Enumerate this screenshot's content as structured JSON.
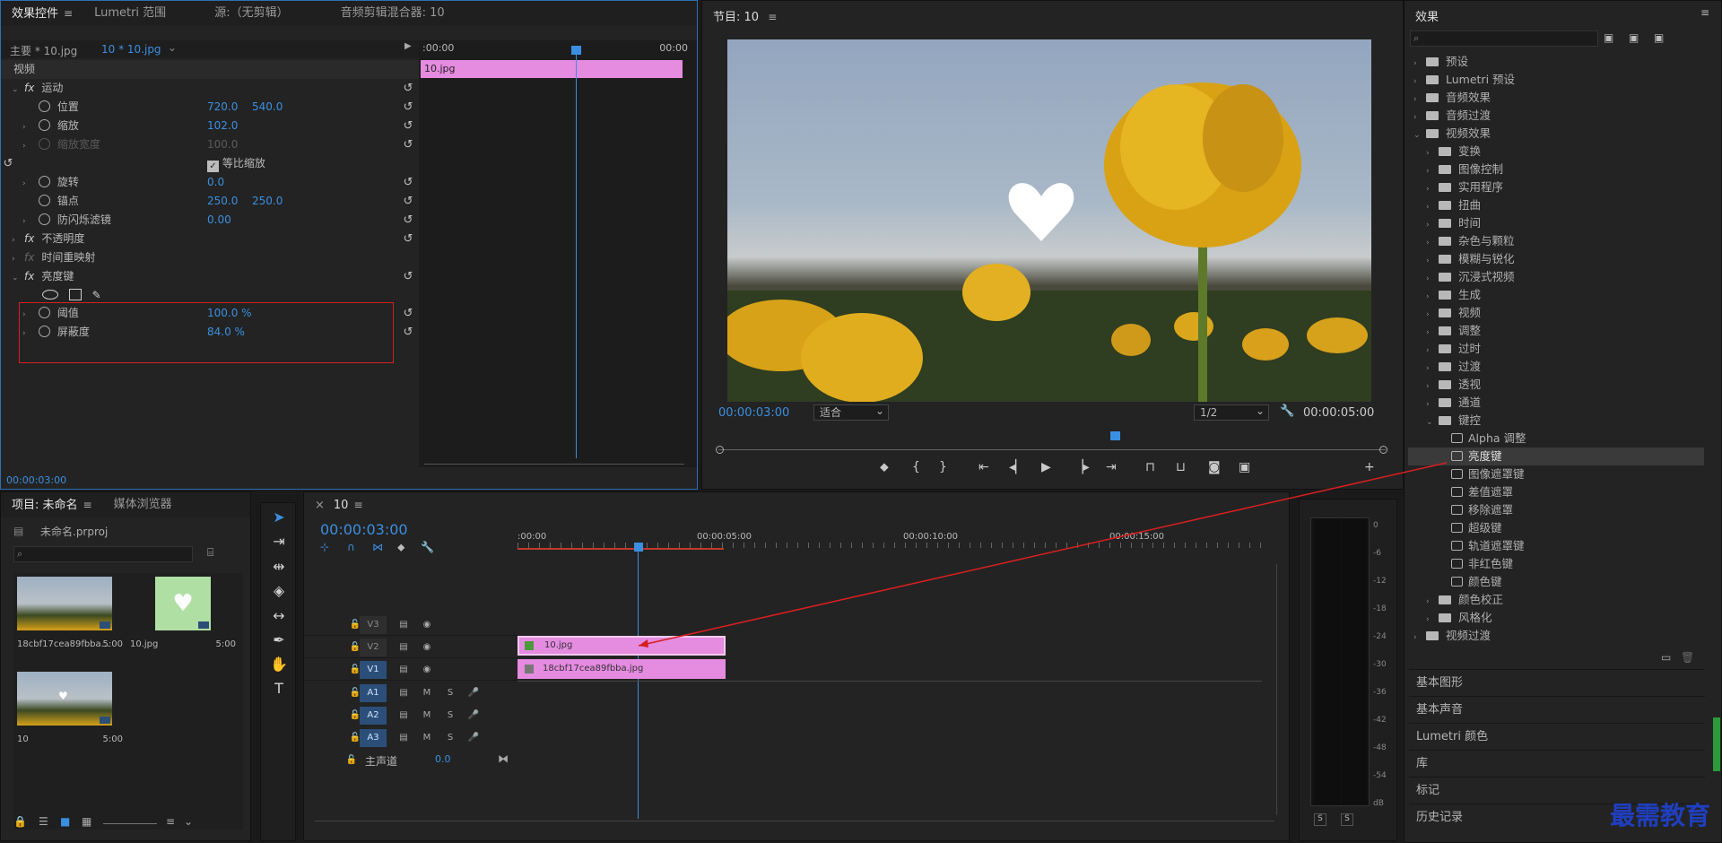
{
  "effect_controls": {
    "tabs": [
      "效果控件",
      "Lumetri 范围",
      "源:（无剪辑）",
      "音频剪辑混合器: 10"
    ],
    "master_clip": "主要 * 10.jpg",
    "seq_clip": "10 * 10.jpg",
    "ruler_start": ":00:00",
    "ruler_end": "00:00",
    "clip_bar": "10.jpg",
    "section_video": "视频",
    "motion": "运动",
    "props": [
      {
        "name": "位置",
        "v1": "720.0",
        "v2": "540.0"
      },
      {
        "name": "缩放",
        "v1": "102.0"
      },
      {
        "name": "缩放宽度",
        "v1": "100.0"
      },
      {
        "name": "等比缩放"
      },
      {
        "name": "旋转",
        "v1": "0.0"
      },
      {
        "name": "锚点",
        "v1": "250.0",
        "v2": "250.0"
      },
      {
        "name": "防闪烁滤镜",
        "v1": "0.00"
      }
    ],
    "opacity": "不透明度",
    "timeremap": "时间重映射",
    "lumakey": "亮度键",
    "threshold": {
      "name": "阈值",
      "value": "100.0 %"
    },
    "cutoff": {
      "name": "屏蔽度",
      "value": "84.0 %"
    },
    "timecode": "00:00:03:00"
  },
  "program": {
    "title": "节目: 10",
    "timecode": "00:00:03:00",
    "fit": "适合",
    "quality": "1/2",
    "duration": "00:00:05:00"
  },
  "effects": {
    "title": "效果",
    "tree": [
      {
        "label": "预设",
        "d": 0,
        "t": "bin"
      },
      {
        "label": "Lumetri 预设",
        "d": 0,
        "t": "bin"
      },
      {
        "label": "音频效果",
        "d": 0,
        "t": "f"
      },
      {
        "label": "音频过渡",
        "d": 0,
        "t": "f"
      },
      {
        "label": "视频效果",
        "d": 0,
        "t": "f",
        "open": true
      },
      {
        "label": "变换",
        "d": 1,
        "t": "f"
      },
      {
        "label": "图像控制",
        "d": 1,
        "t": "f"
      },
      {
        "label": "实用程序",
        "d": 1,
        "t": "f"
      },
      {
        "label": "扭曲",
        "d": 1,
        "t": "f"
      },
      {
        "label": "时间",
        "d": 1,
        "t": "f"
      },
      {
        "label": "杂色与颗粒",
        "d": 1,
        "t": "f"
      },
      {
        "label": "模糊与锐化",
        "d": 1,
        "t": "f"
      },
      {
        "label": "沉浸式视频",
        "d": 1,
        "t": "f"
      },
      {
        "label": "生成",
        "d": 1,
        "t": "f"
      },
      {
        "label": "视频",
        "d": 1,
        "t": "f"
      },
      {
        "label": "调整",
        "d": 1,
        "t": "f"
      },
      {
        "label": "过时",
        "d": 1,
        "t": "f"
      },
      {
        "label": "过渡",
        "d": 1,
        "t": "f"
      },
      {
        "label": "透视",
        "d": 1,
        "t": "f"
      },
      {
        "label": "通道",
        "d": 1,
        "t": "f"
      },
      {
        "label": "键控",
        "d": 1,
        "t": "f",
        "open": true
      },
      {
        "label": "Alpha 调整",
        "d": 2,
        "t": "e"
      },
      {
        "label": "亮度键",
        "d": 2,
        "t": "e",
        "sel": true
      },
      {
        "label": "图像遮罩键",
        "d": 2,
        "t": "e"
      },
      {
        "label": "差值遮罩",
        "d": 2,
        "t": "e"
      },
      {
        "label": "移除遮罩",
        "d": 2,
        "t": "e"
      },
      {
        "label": "超级键",
        "d": 2,
        "t": "e"
      },
      {
        "label": "轨道遮罩键",
        "d": 2,
        "t": "e"
      },
      {
        "label": "非红色键",
        "d": 2,
        "t": "e"
      },
      {
        "label": "颜色键",
        "d": 2,
        "t": "e"
      },
      {
        "label": "颜色校正",
        "d": 1,
        "t": "f"
      },
      {
        "label": "风格化",
        "d": 1,
        "t": "f"
      },
      {
        "label": "视频过渡",
        "d": 0,
        "t": "f"
      }
    ],
    "sections": [
      "基本图形",
      "基本声音",
      "Lumetri 颜色",
      "库",
      "标记",
      "历史记录"
    ]
  },
  "project": {
    "tabs": [
      "项目: 未命名",
      "媒体浏览器"
    ],
    "file": "未命名.prproj",
    "items": [
      {
        "name": "18cbf17cea89fbba...",
        "dur": "5:00"
      },
      {
        "name": "10.jpg",
        "dur": "5:00"
      },
      {
        "name": "10",
        "dur": "5:00"
      }
    ]
  },
  "timeline": {
    "seq": "10",
    "timecode": "00:00:03:00",
    "ruler": [
      ":00:00",
      "00:00:05:00",
      "00:00:10:00",
      "00:00:15:00"
    ],
    "video_tracks": [
      "V3",
      "V2",
      "V1"
    ],
    "audio_tracks": [
      "A1",
      "A2",
      "A3"
    ],
    "master": "主声道",
    "master_val": "0.0",
    "clip_v2": "10.jpg",
    "clip_v1": "18cbf17cea89fbba.jpg"
  },
  "meter": {
    "ticks": [
      "0",
      "-6",
      "-12",
      "-18",
      "-24",
      "-30",
      "-36",
      "-42",
      "-48",
      "-54",
      "dB"
    ],
    "s": "S"
  },
  "watermark": "最需教育",
  "colors": {
    "accent": "#3b8fe0",
    "clip": "#e58be0",
    "highlight_box": "#d62020"
  }
}
